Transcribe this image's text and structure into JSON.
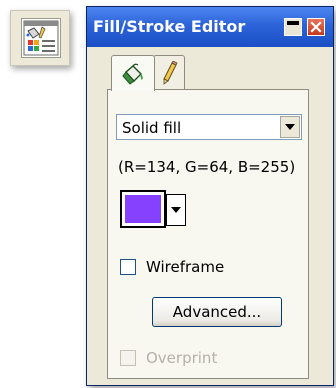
{
  "palette": {
    "title": "Fill/Stroke Editor",
    "titlebar_buttons": [
      "minimize-icon",
      "close-icon"
    ]
  },
  "launcher": {
    "icon": "fill-stroke-palette-icon"
  },
  "tabs": [
    {
      "id": "fill",
      "icon": "paint-bucket-icon",
      "selected": true
    },
    {
      "id": "stroke",
      "icon": "pencil-icon",
      "selected": false
    }
  ],
  "fill_type": {
    "value": "Solid fill"
  },
  "color": {
    "readout": "(R=134, G=64, B=255)",
    "hex": "#8640ff"
  },
  "wireframe": {
    "label": "Wireframe",
    "checked": false
  },
  "advanced_button": {
    "label": "Advanced..."
  },
  "overprint": {
    "label": "Overprint",
    "checked": false,
    "enabled": false
  },
  "colors": {
    "title_bar": "#2d63d9",
    "window_bg": "#ece9d8",
    "close_button": "#c4391e"
  }
}
